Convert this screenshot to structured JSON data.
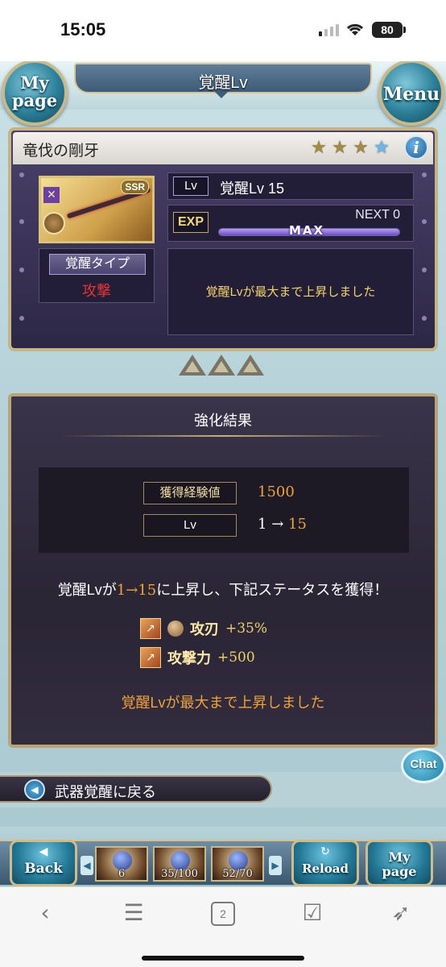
{
  "status_bar": {
    "time": "15:05",
    "battery": "80"
  },
  "header": {
    "title": "覚醒Lv",
    "mypage_label_1": "My",
    "mypage_label_2": "page",
    "menu_label": "Menu"
  },
  "weapon": {
    "name": "竜伐の剛牙",
    "rarity": "SSR",
    "star_icons": [
      "star-icon",
      "star-icon",
      "star-icon",
      "star-icon"
    ],
    "awakening_type_label": "覚醒タイプ",
    "awakening_type_value": "攻撃",
    "lv_tag": "Lv",
    "lv_text": "覚醒Lv 15",
    "exp_tag": "EXP",
    "next_text": "NEXT 0",
    "max_label": "MAX",
    "exp_progress": 1.0,
    "message": "覚醒Lvが最大まで上昇しました"
  },
  "result": {
    "title": "強化結果",
    "exp_label": "獲得経験値",
    "exp_value": "1500",
    "lv_label": "Lv",
    "lv_from": "1",
    "lv_arrow": "→",
    "lv_to": "15",
    "sentence_pre": "覚醒Lvが",
    "sentence_num": "1→15",
    "sentence_post": "に上昇し、下記ステータスを獲得！",
    "stats": [
      {
        "name": "攻刃",
        "value": "+35%"
      },
      {
        "name": "攻撃力",
        "value": "+500"
      }
    ],
    "footer_message": "覚醒Lvが最大まで上昇しました"
  },
  "chat_label": "Chat",
  "back_link_label": "武器覚醒に戻る",
  "footer": {
    "back_label": "Back",
    "reload_label": "Reload",
    "mypage_label_1": "My",
    "mypage_label_2": "page",
    "items": [
      {
        "count": "6"
      },
      {
        "count": "35/100"
      },
      {
        "count": "52/70"
      }
    ]
  },
  "browser": {
    "tabs_count": "2"
  },
  "colors": {
    "accent_gold": "#c6b486",
    "orange": "#f0a23a",
    "panel": "#2d2746"
  }
}
